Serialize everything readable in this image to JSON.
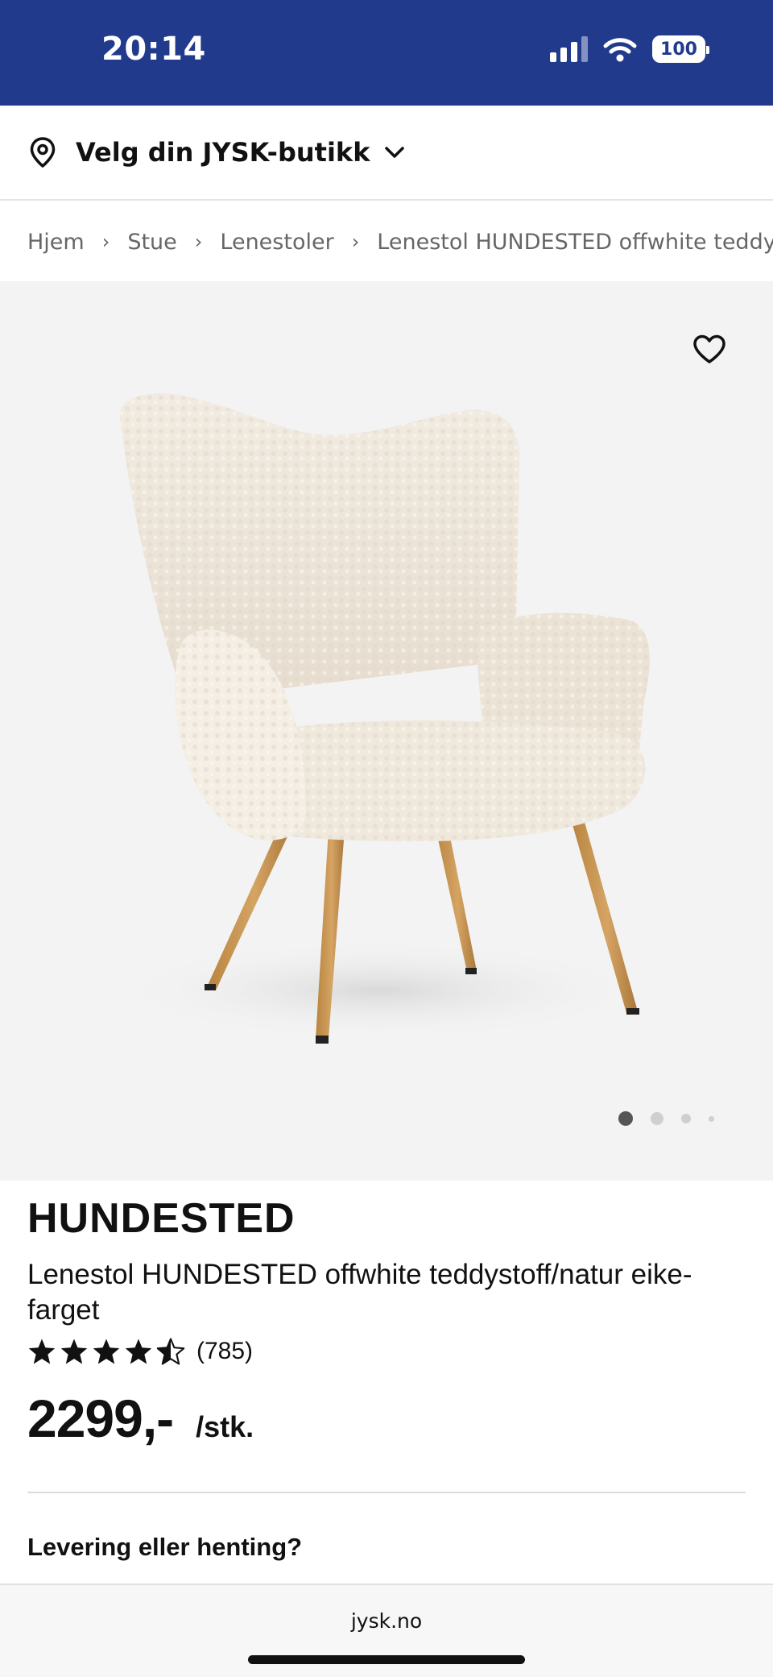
{
  "status_bar": {
    "time": "20:14",
    "battery": "100",
    "icons": [
      "signal-icon",
      "wifi-icon",
      "battery-icon"
    ]
  },
  "store": {
    "label": "Velg din JYSK-butikk",
    "icons": [
      "location-pin-icon",
      "chevron-down-icon"
    ]
  },
  "breadcrumb": [
    "Hjem",
    "Stue",
    "Lenestoler",
    "Lenestol HUNDESTED offwhite teddystc"
  ],
  "gallery": {
    "image_count": 4,
    "active_index": 0,
    "icons": [
      "heart-icon"
    ]
  },
  "product": {
    "brand": "HUNDESTED",
    "name": "Lenestol HUNDESTED offwhite teddystoff/natur eike-farget",
    "rating": 4.5,
    "rating_max": 5,
    "review_count": "(785)",
    "price": "2299,-",
    "unit": "/stk.",
    "delivery_heading": "Levering eller henting?"
  },
  "browser": {
    "url": "jysk.no"
  },
  "colors": {
    "status_bar_bg": "#223a8c",
    "gallery_bg": "#f3f3f3",
    "text": "#111111"
  }
}
